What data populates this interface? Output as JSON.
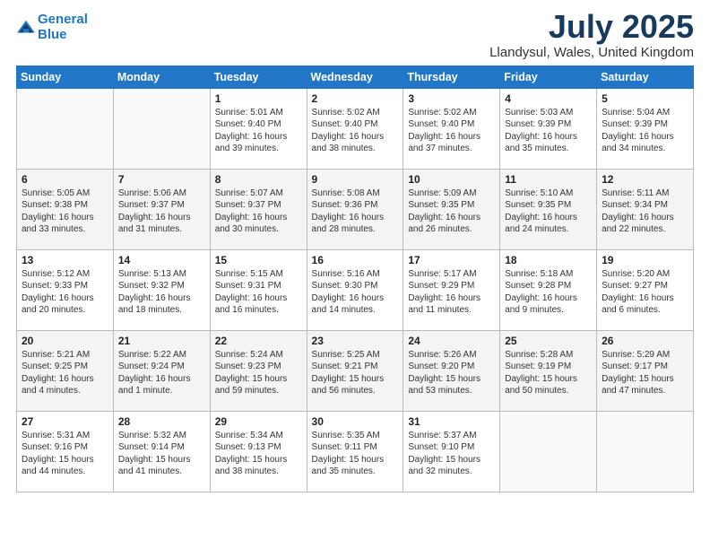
{
  "logo": {
    "line1": "General",
    "line2": "Blue"
  },
  "title": "July 2025",
  "location": "Llandysul, Wales, United Kingdom",
  "days_of_week": [
    "Sunday",
    "Monday",
    "Tuesday",
    "Wednesday",
    "Thursday",
    "Friday",
    "Saturday"
  ],
  "weeks": [
    [
      {
        "day": "",
        "info": ""
      },
      {
        "day": "",
        "info": ""
      },
      {
        "day": "1",
        "info": "Sunrise: 5:01 AM\nSunset: 9:40 PM\nDaylight: 16 hours\nand 39 minutes."
      },
      {
        "day": "2",
        "info": "Sunrise: 5:02 AM\nSunset: 9:40 PM\nDaylight: 16 hours\nand 38 minutes."
      },
      {
        "day": "3",
        "info": "Sunrise: 5:02 AM\nSunset: 9:40 PM\nDaylight: 16 hours\nand 37 minutes."
      },
      {
        "day": "4",
        "info": "Sunrise: 5:03 AM\nSunset: 9:39 PM\nDaylight: 16 hours\nand 35 minutes."
      },
      {
        "day": "5",
        "info": "Sunrise: 5:04 AM\nSunset: 9:39 PM\nDaylight: 16 hours\nand 34 minutes."
      }
    ],
    [
      {
        "day": "6",
        "info": "Sunrise: 5:05 AM\nSunset: 9:38 PM\nDaylight: 16 hours\nand 33 minutes."
      },
      {
        "day": "7",
        "info": "Sunrise: 5:06 AM\nSunset: 9:37 PM\nDaylight: 16 hours\nand 31 minutes."
      },
      {
        "day": "8",
        "info": "Sunrise: 5:07 AM\nSunset: 9:37 PM\nDaylight: 16 hours\nand 30 minutes."
      },
      {
        "day": "9",
        "info": "Sunrise: 5:08 AM\nSunset: 9:36 PM\nDaylight: 16 hours\nand 28 minutes."
      },
      {
        "day": "10",
        "info": "Sunrise: 5:09 AM\nSunset: 9:35 PM\nDaylight: 16 hours\nand 26 minutes."
      },
      {
        "day": "11",
        "info": "Sunrise: 5:10 AM\nSunset: 9:35 PM\nDaylight: 16 hours\nand 24 minutes."
      },
      {
        "day": "12",
        "info": "Sunrise: 5:11 AM\nSunset: 9:34 PM\nDaylight: 16 hours\nand 22 minutes."
      }
    ],
    [
      {
        "day": "13",
        "info": "Sunrise: 5:12 AM\nSunset: 9:33 PM\nDaylight: 16 hours\nand 20 minutes."
      },
      {
        "day": "14",
        "info": "Sunrise: 5:13 AM\nSunset: 9:32 PM\nDaylight: 16 hours\nand 18 minutes."
      },
      {
        "day": "15",
        "info": "Sunrise: 5:15 AM\nSunset: 9:31 PM\nDaylight: 16 hours\nand 16 minutes."
      },
      {
        "day": "16",
        "info": "Sunrise: 5:16 AM\nSunset: 9:30 PM\nDaylight: 16 hours\nand 14 minutes."
      },
      {
        "day": "17",
        "info": "Sunrise: 5:17 AM\nSunset: 9:29 PM\nDaylight: 16 hours\nand 11 minutes."
      },
      {
        "day": "18",
        "info": "Sunrise: 5:18 AM\nSunset: 9:28 PM\nDaylight: 16 hours\nand 9 minutes."
      },
      {
        "day": "19",
        "info": "Sunrise: 5:20 AM\nSunset: 9:27 PM\nDaylight: 16 hours\nand 6 minutes."
      }
    ],
    [
      {
        "day": "20",
        "info": "Sunrise: 5:21 AM\nSunset: 9:25 PM\nDaylight: 16 hours\nand 4 minutes."
      },
      {
        "day": "21",
        "info": "Sunrise: 5:22 AM\nSunset: 9:24 PM\nDaylight: 16 hours\nand 1 minute."
      },
      {
        "day": "22",
        "info": "Sunrise: 5:24 AM\nSunset: 9:23 PM\nDaylight: 15 hours\nand 59 minutes."
      },
      {
        "day": "23",
        "info": "Sunrise: 5:25 AM\nSunset: 9:21 PM\nDaylight: 15 hours\nand 56 minutes."
      },
      {
        "day": "24",
        "info": "Sunrise: 5:26 AM\nSunset: 9:20 PM\nDaylight: 15 hours\nand 53 minutes."
      },
      {
        "day": "25",
        "info": "Sunrise: 5:28 AM\nSunset: 9:19 PM\nDaylight: 15 hours\nand 50 minutes."
      },
      {
        "day": "26",
        "info": "Sunrise: 5:29 AM\nSunset: 9:17 PM\nDaylight: 15 hours\nand 47 minutes."
      }
    ],
    [
      {
        "day": "27",
        "info": "Sunrise: 5:31 AM\nSunset: 9:16 PM\nDaylight: 15 hours\nand 44 minutes."
      },
      {
        "day": "28",
        "info": "Sunrise: 5:32 AM\nSunset: 9:14 PM\nDaylight: 15 hours\nand 41 minutes."
      },
      {
        "day": "29",
        "info": "Sunrise: 5:34 AM\nSunset: 9:13 PM\nDaylight: 15 hours\nand 38 minutes."
      },
      {
        "day": "30",
        "info": "Sunrise: 5:35 AM\nSunset: 9:11 PM\nDaylight: 15 hours\nand 35 minutes."
      },
      {
        "day": "31",
        "info": "Sunrise: 5:37 AM\nSunset: 9:10 PM\nDaylight: 15 hours\nand 32 minutes."
      },
      {
        "day": "",
        "info": ""
      },
      {
        "day": "",
        "info": ""
      }
    ]
  ]
}
